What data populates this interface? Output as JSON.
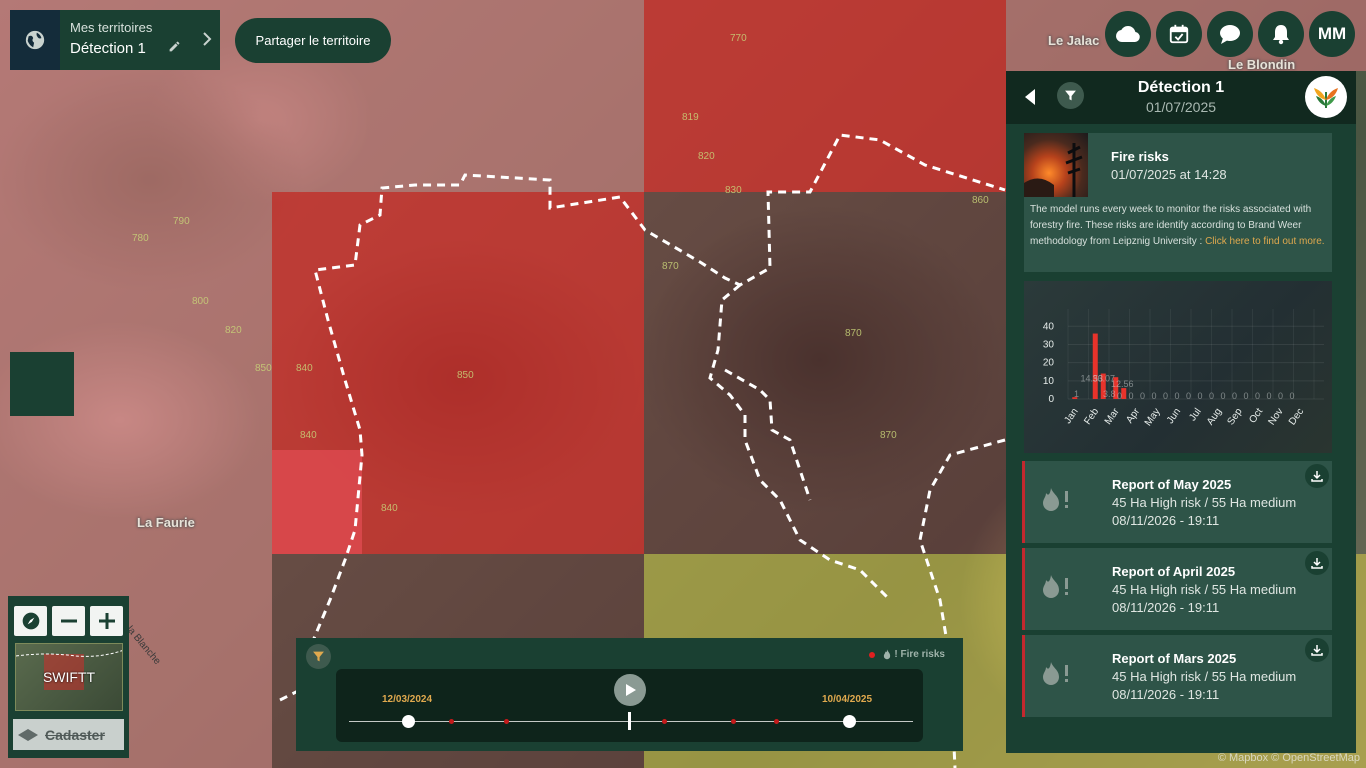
{
  "territory": {
    "caption": "Mes territoires",
    "name": "Détection 1"
  },
  "share_button_label": "Partager le territoire",
  "top_icons": [
    "cloud-icon",
    "calendar-check-icon",
    "chat-icon",
    "bell-icon"
  ],
  "user_initials": "MM",
  "map": {
    "place_labels": {
      "la_faurie": "La Faurie",
      "le_jalac": "Le Jalac",
      "le_blondin": "Le Blondin",
      "la_blanche": "la Blanche"
    },
    "contour_labels": [
      "770",
      "819",
      "820",
      "830",
      "860",
      "790",
      "780",
      "800",
      "820",
      "850",
      "840",
      "840",
      "850",
      "840",
      "870",
      "870",
      "870"
    ],
    "attribution": "© Mapbox © OpenStreetMap"
  },
  "map_tools": {
    "minimap_label": "SWIFTT",
    "cadastre_label": "Cadaster"
  },
  "timeline": {
    "legend_label": "Fire risks",
    "start_date": "12/03/2024",
    "end_date": "10/04/2025"
  },
  "panel": {
    "title": "Détection 1",
    "date": "01/07/2025",
    "fire_card": {
      "title": "Fire risks",
      "datetime": "01/07/2025 at 14:28",
      "description": "The model runs every week to monitor the risks associated with forestry fire. These risks are identify according to Brand Weer methodology from Leipznig University : ",
      "link_text": "Click here to find out more."
    },
    "reports": [
      {
        "title": "Report of May 2025",
        "summary": "45 Ha High risk / 55 Ha medium",
        "date": "08/11/2026 - 19:11"
      },
      {
        "title": "Report of April 2025",
        "summary": "45 Ha High risk / 55 Ha medium",
        "date": "08/11/2026 - 19:11"
      },
      {
        "title": "Report of Mars 2025",
        "summary": "45 Ha High risk / 55 Ha medium",
        "date": "08/11/2026 - 19:11"
      }
    ]
  },
  "chart_data": {
    "type": "bar",
    "categories": [
      "Jan",
      "Feb",
      "Mar",
      "Apr",
      "May",
      "Jun",
      "Jul",
      "Aug",
      "Sep",
      "Oct",
      "Nov",
      "Dec"
    ],
    "series": [
      {
        "values": [
          1,
          36,
          12,
          0,
          0,
          0,
          0,
          0,
          0,
          0,
          0,
          0
        ],
        "color": "#e8332b"
      },
      {
        "values": [
          0,
          14,
          6,
          0,
          0,
          0,
          0,
          0,
          0,
          0,
          0,
          0
        ],
        "color": "#e8332b"
      }
    ],
    "y_ticks": [
      0,
      10,
      20,
      30,
      40
    ],
    "ylim": [
      0,
      44
    ],
    "data_labels": [
      "1",
      "36.07",
      "14.53",
      "12.56",
      "3.8",
      "0",
      "0",
      "0",
      "0",
      "0",
      "0",
      "0",
      "0",
      "0",
      "0",
      "0",
      "0",
      "0",
      "0",
      "0",
      "0"
    ],
    "grid": true
  }
}
